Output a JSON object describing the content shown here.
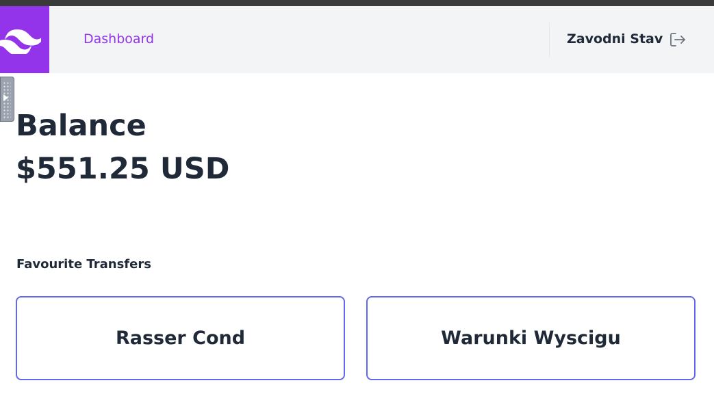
{
  "header": {
    "nav_link": "Dashboard",
    "user_name": "Zavodni Stav",
    "logo_icon": "tailwind-logo-icon",
    "logout_icon": "logout-icon",
    "brand_color": "#9333ea"
  },
  "balance": {
    "title": "Balance",
    "value": "$551.25 USD"
  },
  "favourites": {
    "title": "Favourite Transfers",
    "items": [
      {
        "label": "Rasser Cond"
      },
      {
        "label": "Warunki Wyscigu"
      }
    ],
    "border_color": "#6366f1"
  }
}
